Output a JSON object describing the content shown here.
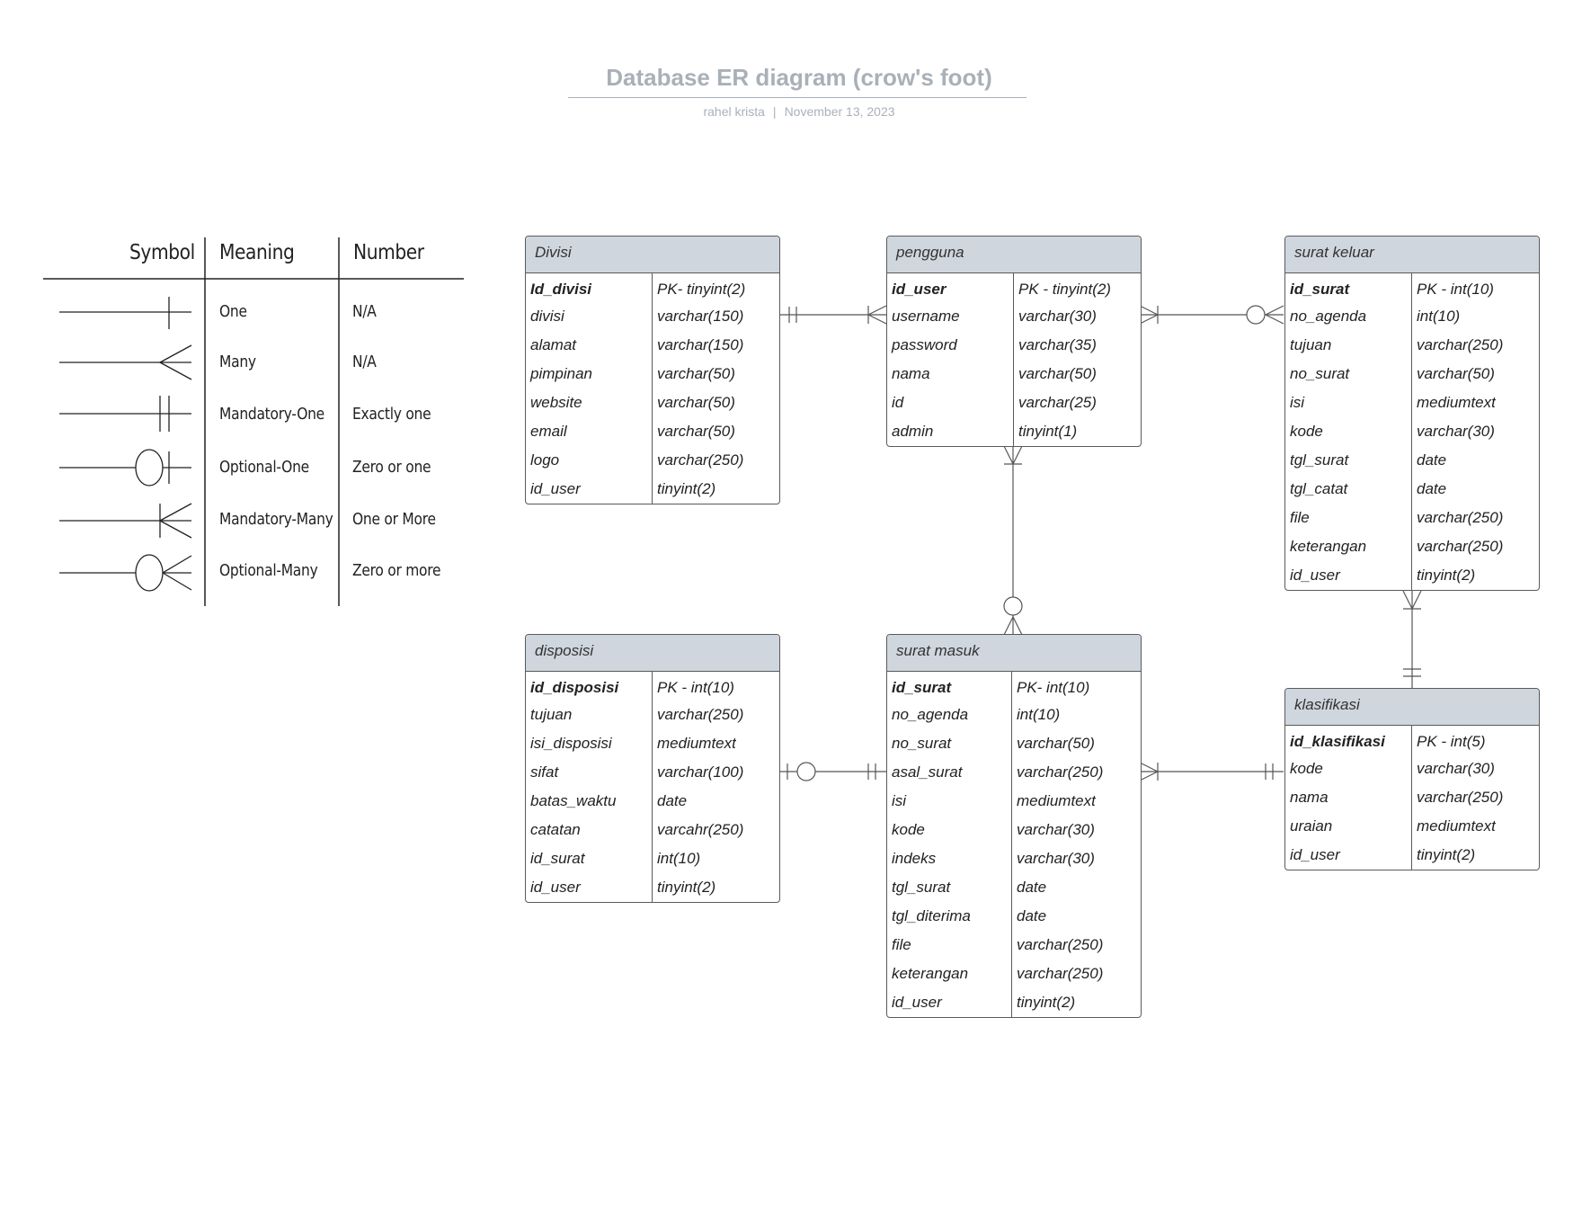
{
  "title": "Database ER diagram (crow's foot)",
  "author": "rahel krista",
  "date": "November 13, 2023",
  "legend": {
    "headers": [
      "Symbol",
      "Meaning",
      "Number"
    ],
    "rows": [
      {
        "symbol": "one-icon",
        "meaning": "One",
        "number": "N/A"
      },
      {
        "symbol": "many-icon",
        "meaning": "Many",
        "number": "N/A"
      },
      {
        "symbol": "mandatory-one-icon",
        "meaning": "Mandatory-One",
        "number": "Exactly one"
      },
      {
        "symbol": "optional-one-icon",
        "meaning": "Optional-One",
        "number": "Zero or one"
      },
      {
        "symbol": "mandatory-many-icon",
        "meaning": "Mandatory-Many",
        "number": "One or More"
      },
      {
        "symbol": "optional-many-icon",
        "meaning": "Optional-Many",
        "number": "Zero or more"
      }
    ]
  },
  "entities": {
    "divisi": {
      "name": "Divisi",
      "fields": [
        [
          "Id_divisi",
          "PK- tinyint(2)"
        ],
        [
          "divisi",
          "varchar(150)"
        ],
        [
          "alamat",
          "varchar(150)"
        ],
        [
          "pimpinan",
          "varchar(50)"
        ],
        [
          "website",
          "varchar(50)"
        ],
        [
          "email",
          "varchar(50)"
        ],
        [
          "logo",
          "varchar(250)"
        ],
        [
          "id_user",
          "tinyint(2)"
        ]
      ]
    },
    "pengguna": {
      "name": "pengguna",
      "fields": [
        [
          "id_user",
          "PK - tinyint(2)"
        ],
        [
          "username",
          "varchar(30)"
        ],
        [
          "password",
          "varchar(35)"
        ],
        [
          "nama",
          "varchar(50)"
        ],
        [
          "id",
          "varchar(25)"
        ],
        [
          "admin",
          "tinyint(1)"
        ]
      ]
    },
    "surat_keluar": {
      "name": "surat keluar",
      "fields": [
        [
          "id_surat",
          "PK - int(10)"
        ],
        [
          "no_agenda",
          "int(10)"
        ],
        [
          "tujuan",
          "varchar(250)"
        ],
        [
          "no_surat",
          "varchar(50)"
        ],
        [
          "isi",
          "mediumtext"
        ],
        [
          "kode",
          "varchar(30)"
        ],
        [
          "tgl_surat",
          "date"
        ],
        [
          "tgl_catat",
          "date"
        ],
        [
          "file",
          "varchar(250)"
        ],
        [
          "keterangan",
          "varchar(250)"
        ],
        [
          "id_user",
          "tinyint(2)"
        ]
      ]
    },
    "disposisi": {
      "name": "disposisi",
      "fields": [
        [
          "id_disposisi",
          "PK - int(10)"
        ],
        [
          "tujuan",
          "varchar(250)"
        ],
        [
          "isi_disposisi",
          "mediumtext"
        ],
        [
          "sifat",
          "varchar(100)"
        ],
        [
          "batas_waktu",
          "date"
        ],
        [
          "catatan",
          "varcahr(250)"
        ],
        [
          "id_surat",
          "int(10)"
        ],
        [
          "id_user",
          "tinyint(2)"
        ]
      ]
    },
    "surat_masuk": {
      "name": "surat masuk",
      "fields": [
        [
          "id_surat",
          "PK- int(10)"
        ],
        [
          "no_agenda",
          "int(10)"
        ],
        [
          "no_surat",
          "varchar(50)"
        ],
        [
          "asal_surat",
          "varchar(250)"
        ],
        [
          "isi",
          "mediumtext"
        ],
        [
          "kode",
          "varchar(30)"
        ],
        [
          "indeks",
          "varchar(30)"
        ],
        [
          "tgl_surat",
          "date"
        ],
        [
          "tgl_diterima",
          "date"
        ],
        [
          "file",
          "varchar(250)"
        ],
        [
          "keterangan",
          "varchar(250)"
        ],
        [
          "id_user",
          "tinyint(2)"
        ]
      ]
    },
    "klasifikasi": {
      "name": "klasifikasi",
      "fields": [
        [
          "id_klasifikasi",
          "PK - int(5)"
        ],
        [
          "kode",
          "varchar(30)"
        ],
        [
          "nama",
          "varchar(250)"
        ],
        [
          "uraian",
          "mediumtext"
        ],
        [
          "id_user",
          "tinyint(2)"
        ]
      ]
    }
  },
  "relationships": [
    {
      "from": "Divisi",
      "from_end": "mandatory-one",
      "to": "pengguna",
      "to_end": "mandatory-many"
    },
    {
      "from": "pengguna",
      "from_end": "mandatory-many",
      "to": "surat keluar",
      "to_end": "optional-many"
    },
    {
      "from": "pengguna",
      "from_end": "mandatory-many",
      "to": "surat masuk",
      "to_end": "optional-many"
    },
    {
      "from": "surat keluar",
      "from_end": "mandatory-many",
      "to": "klasifikasi",
      "to_end": "mandatory-one"
    },
    {
      "from": "disposisi",
      "from_end": "optional-one",
      "to": "surat masuk",
      "to_end": "mandatory-one"
    },
    {
      "from": "surat masuk",
      "from_end": "mandatory-many",
      "to": "klasifikasi",
      "to_end": "mandatory-one"
    }
  ]
}
